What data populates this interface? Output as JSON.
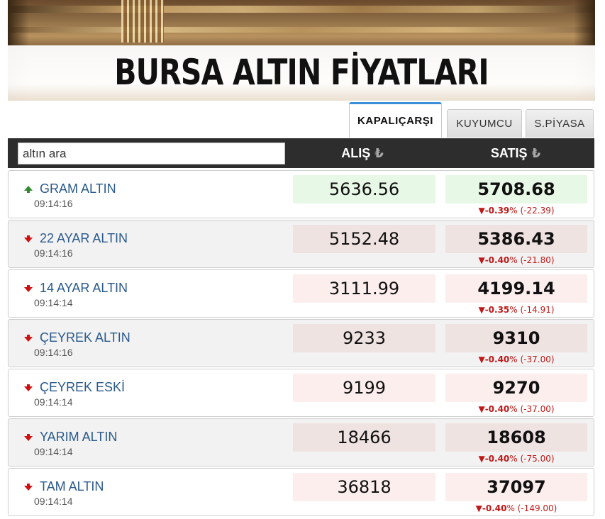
{
  "banner": {
    "title": "BURSA ALTIN FİYATLARI"
  },
  "tabs": [
    {
      "label": "KAPALIÇARŞI",
      "active": true
    },
    {
      "label": "KUYUMCU",
      "active": false
    },
    {
      "label": "S.PİYASA",
      "active": false
    }
  ],
  "search": {
    "placeholder": "altın ara",
    "value": ""
  },
  "columns": {
    "buy": "ALIŞ",
    "sell": "SATIŞ",
    "currency_symbol": "₺"
  },
  "colors": {
    "up": "#2e8b2e",
    "down": "#d01010",
    "name": "#2a5a8c",
    "header_bg": "#2d2d2d"
  },
  "rows": [
    {
      "name": "GRAM ALTIN",
      "time": "09:14:16",
      "trend": "up",
      "buy": "5636.56",
      "sell": "5708.68",
      "pct": "-0.39",
      "change": "(-22.39)"
    },
    {
      "name": "22 AYAR ALTIN",
      "time": "09:14:16",
      "trend": "down",
      "buy": "5152.48",
      "sell": "5386.43",
      "pct": "-0.40",
      "change": "(-21.80)"
    },
    {
      "name": "14 AYAR ALTIN",
      "time": "09:14:14",
      "trend": "down",
      "buy": "3111.99",
      "sell": "4199.14",
      "pct": "-0.35",
      "change": "(-14.91)"
    },
    {
      "name": "ÇEYREK ALTIN",
      "time": "09:14:16",
      "trend": "down",
      "buy": "9233",
      "sell": "9310",
      "pct": "-0.40",
      "change": "(-37.00)"
    },
    {
      "name": "ÇEYREK ESKİ",
      "time": "09:14:14",
      "trend": "down",
      "buy": "9199",
      "sell": "9270",
      "pct": "-0.40",
      "change": "(-37.00)"
    },
    {
      "name": "YARIM ALTIN",
      "time": "09:14:14",
      "trend": "down",
      "buy": "18466",
      "sell": "18608",
      "pct": "-0.40",
      "change": "(-75.00)"
    },
    {
      "name": "TAM ALTIN",
      "time": "09:14:14",
      "trend": "down",
      "buy": "36818",
      "sell": "37097",
      "pct": "-0.40",
      "change": "(-149.00)"
    }
  ]
}
